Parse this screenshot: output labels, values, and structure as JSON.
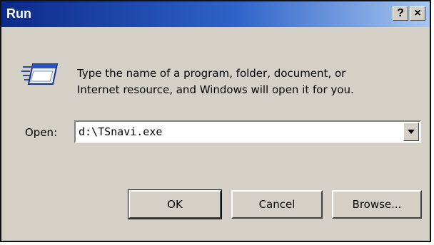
{
  "window": {
    "title": "Run",
    "help_label": "?",
    "close_label": "×"
  },
  "description": {
    "line1": "Type the name of a program, folder, document, or",
    "line2": "Internet resource, and Windows will open it for you."
  },
  "open_field": {
    "label": "Open:",
    "value": "d:\\TSnavi.exe"
  },
  "buttons": {
    "ok": "OK",
    "cancel": "Cancel",
    "browse": "Browse..."
  },
  "icons": {
    "run": "run-program-icon",
    "dropdown": "chevron-down-icon"
  },
  "colors": {
    "titlebar_start": "#0b2a8a",
    "titlebar_end": "#a6c7f0",
    "face": "#d4d0c8"
  }
}
